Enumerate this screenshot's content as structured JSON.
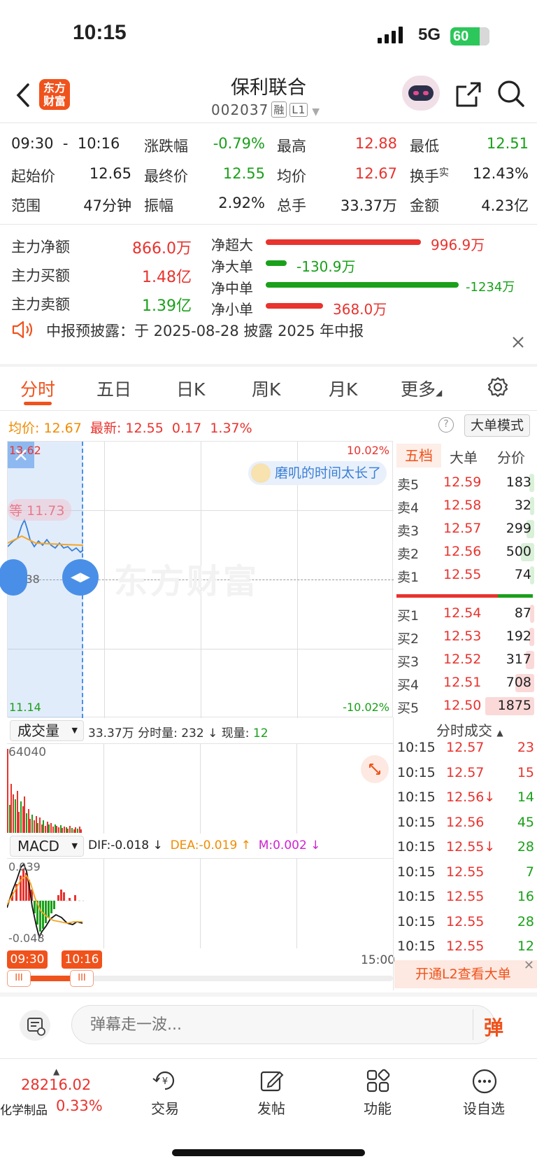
{
  "status": {
    "time": "10:15",
    "network": "5G",
    "battery": "60"
  },
  "header": {
    "title": "保利联合",
    "code": "002037",
    "tag1": "融",
    "tag2": "L1",
    "logo": "东方财富"
  },
  "stats": {
    "time_from": "09:30",
    "dash": "-",
    "time_to": "10:16",
    "rows": [
      [
        {
          "l": "涨跌幅",
          "v": "-0.79%"
        },
        {
          "l": "最高",
          "v": "12.88"
        },
        {
          "l": "最低",
          "v": "12.51"
        }
      ],
      [
        {
          "l": "起始价",
          "v": "12.65"
        },
        {
          "l": "最终价",
          "v": "12.55"
        },
        {
          "l": "均价",
          "v": "12.67"
        },
        {
          "l": "换手",
          "sup": "实",
          "v": "12.43%"
        }
      ],
      [
        {
          "l": "范围",
          "v": "47分钟"
        },
        {
          "l": "振幅",
          "v": "2.92%"
        },
        {
          "l": "总手",
          "v": "33.37万"
        },
        {
          "l": "金额",
          "v": "4.23亿"
        }
      ]
    ]
  },
  "flow": {
    "left": [
      {
        "l": "主力净额",
        "v": "866.0万"
      },
      {
        "l": "主力买额",
        "v": "1.48亿"
      },
      {
        "l": "主力卖额",
        "v": "1.39亿"
      }
    ],
    "right": [
      {
        "l": "净超大",
        "v": "996.9万",
        "ratio": 0.81
      },
      {
        "l": "净大单",
        "v": "-130.9万",
        "ratio": 0.11
      },
      {
        "l": "净中单",
        "v": "-1234万",
        "ratio": 1.0
      },
      {
        "l": "净小单",
        "v": "368.0万",
        "ratio": 0.3
      }
    ]
  },
  "notice": "中报预披露：于 2025-08-28 披露 2025 年中报",
  "tabs": [
    "分时",
    "五日",
    "日K",
    "周K",
    "月K",
    "更多"
  ],
  "price_line": {
    "avg_label": "均价:",
    "avg": "12.67",
    "last_label": "最新:",
    "last": "12.55",
    "chg": "0.17",
    "pct": "1.37%",
    "mode": "大单模式"
  },
  "chart": {
    "top": "13.62",
    "top_pct": "10.02%",
    "mid": "12.38",
    "bottom": "11.14",
    "bottom_pct": "-10.02%",
    "bubble": "等 11.73",
    "danmu": "磨叽的时间太长了",
    "watermark": "东方财富"
  },
  "orderbook": {
    "tabs": [
      "五档",
      "大单",
      "分价"
    ],
    "asks": [
      {
        "l": "卖5",
        "p": "12.59",
        "v": "183",
        "w": 0.1
      },
      {
        "l": "卖4",
        "p": "12.58",
        "v": "32",
        "w": 0.02
      },
      {
        "l": "卖3",
        "p": "12.57",
        "v": "299",
        "w": 0.16
      },
      {
        "l": "卖2",
        "p": "12.56",
        "v": "500",
        "w": 0.27
      },
      {
        "l": "卖1",
        "p": "12.55",
        "v": "74",
        "w": 0.04
      }
    ],
    "bids": [
      {
        "l": "买1",
        "p": "12.54",
        "v": "87",
        "w": 0.05
      },
      {
        "l": "买2",
        "p": "12.53",
        "v": "192",
        "w": 0.1
      },
      {
        "l": "买3",
        "p": "12.52",
        "v": "317",
        "w": 0.17
      },
      {
        "l": "买4",
        "p": "12.51",
        "v": "708",
        "w": 0.38
      },
      {
        "l": "买5",
        "p": "12.50",
        "v": "1875",
        "w": 1.0
      }
    ]
  },
  "volume": {
    "selector": "成交量",
    "total": "33.37万",
    "fen_label": "分时量:",
    "fen": "232",
    "arrow": "↓",
    "now_label": "现量:",
    "now": "12",
    "max": "64040"
  },
  "macd": {
    "selector": "MACD",
    "dif": "DIF:-0.018 ↓",
    "dea": "DEA:-0.019 ↑",
    "m": "M:0.002 ↓",
    "top": "0.039",
    "bottom": "-0.048"
  },
  "trades": {
    "title": "分时成交",
    "rows": [
      {
        "t": "10:15",
        "p": "12.57",
        "v": "23",
        "c": "red"
      },
      {
        "t": "10:15",
        "p": "12.57",
        "v": "15",
        "c": "red"
      },
      {
        "t": "10:15",
        "p": "12.56↓",
        "v": "14",
        "c": "green"
      },
      {
        "t": "10:15",
        "p": "12.56",
        "v": "45",
        "c": "green"
      },
      {
        "t": "10:15",
        "p": "12.55↓",
        "v": "28",
        "c": "green"
      },
      {
        "t": "10:15",
        "p": "12.55",
        "v": "7",
        "c": "green"
      },
      {
        "t": "10:15",
        "p": "12.55",
        "v": "16",
        "c": "green"
      },
      {
        "t": "10:15",
        "p": "12.55",
        "v": "28",
        "c": "green"
      },
      {
        "t": "10:15",
        "p": "12.55",
        "v": "12",
        "c": "green"
      }
    ],
    "l2": "开通L2查看大单"
  },
  "range": {
    "start": "09:30",
    "end": "10:16",
    "close": "15:00"
  },
  "comment": {
    "placeholder": "弹幕走一波...",
    "btn": "弹"
  },
  "nav": {
    "index_value": "28216.02",
    "index_name": "化学制品",
    "index_pct": "0.33%",
    "items": [
      "交易",
      "发帖",
      "功能",
      "设自选"
    ]
  }
}
